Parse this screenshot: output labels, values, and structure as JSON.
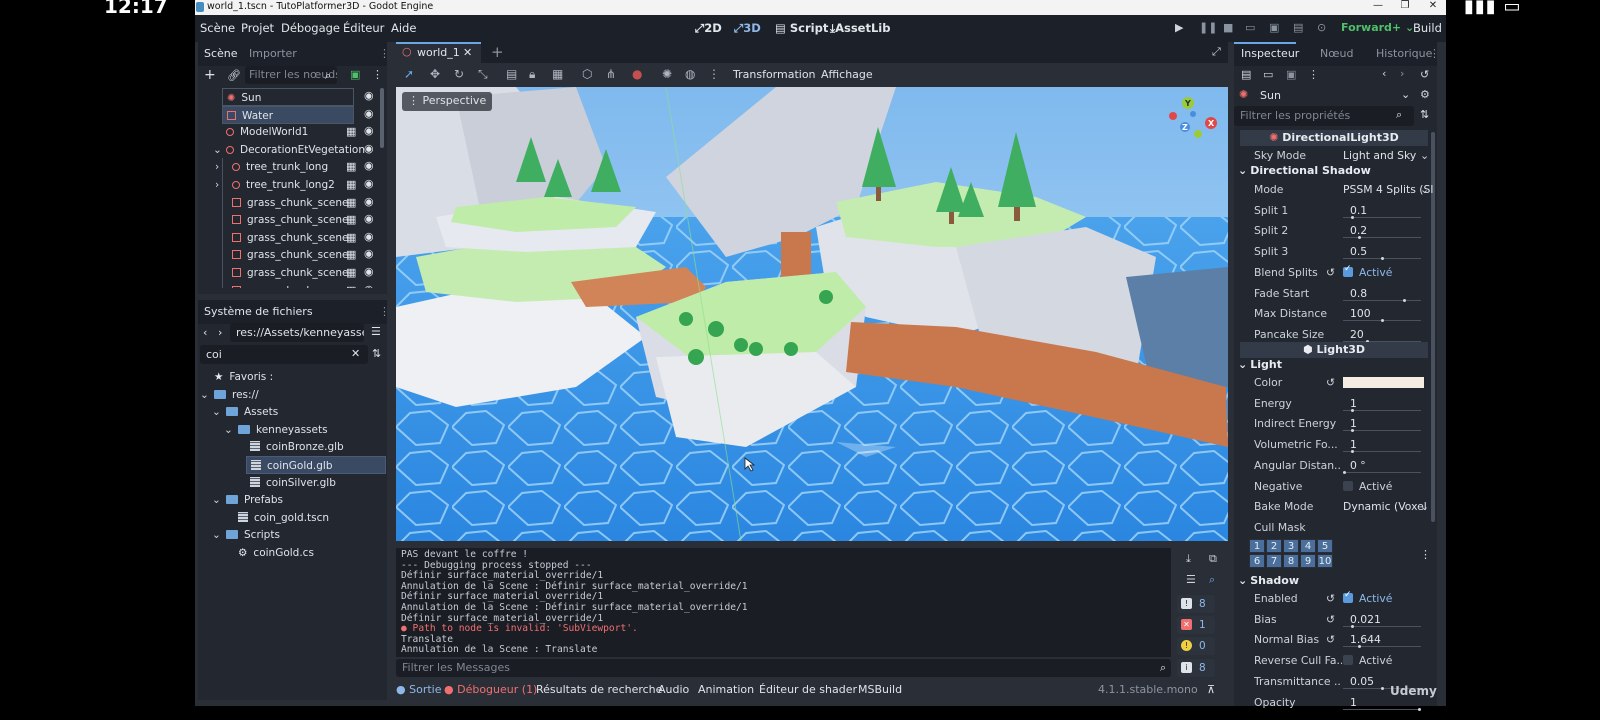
{
  "os": {
    "time": "12:17",
    "status": "▮▮▮ ▭"
  },
  "window": {
    "title": "world_1.tscn - TutoPlatformer3D - Godot Engine",
    "controls": [
      "—",
      "❐",
      "✕"
    ]
  },
  "menu": [
    "Scène",
    "Projet",
    "Débogage",
    "Éditeur",
    "Aide"
  ],
  "workspaces": [
    "2D",
    "3D",
    "Script",
    "AssetLib"
  ],
  "renderer": "Forward+",
  "build": "Build",
  "scene_dock": {
    "tabs": [
      "Scène",
      "Importer"
    ],
    "filter_placeholder": "Filtrer les nœuds",
    "nodes": [
      {
        "name": "Sun",
        "icon": "sun",
        "indent": 0
      },
      {
        "name": "Water",
        "icon": "mesh",
        "indent": 0,
        "selected": true
      },
      {
        "name": "ModelWorld1",
        "icon": "circle",
        "indent": 0,
        "film": true
      },
      {
        "name": "DecorationEtVegetation",
        "icon": "circle",
        "indent": 0,
        "arrow": "⌄"
      },
      {
        "name": "tree_trunk_long",
        "icon": "circle",
        "indent": 1,
        "arrow": "›",
        "film": true
      },
      {
        "name": "tree_trunk_long2",
        "icon": "circle",
        "indent": 1,
        "arrow": "›",
        "film": true
      },
      {
        "name": "grass_chunk_scene",
        "icon": "mesh",
        "indent": 1,
        "film": true
      },
      {
        "name": "grass_chunk_scene",
        "icon": "mesh",
        "indent": 1,
        "film": true
      },
      {
        "name": "grass_chunk_scene",
        "icon": "mesh",
        "indent": 1,
        "film": true
      },
      {
        "name": "grass_chunk_scene",
        "icon": "mesh",
        "indent": 1,
        "film": true
      },
      {
        "name": "grass_chunk_scene",
        "icon": "mesh",
        "indent": 1,
        "film": true
      },
      {
        "name": "grass_chunk_scene",
        "icon": "mesh",
        "indent": 1,
        "film": true
      }
    ]
  },
  "filesystem": {
    "title": "Système de fichiers",
    "path": "res://Assets/kenneyassets",
    "search": "coi",
    "items": [
      {
        "label": "Favoris :",
        "type": "star",
        "indent": 0
      },
      {
        "label": "res://",
        "type": "folder",
        "indent": 0
      },
      {
        "label": "Assets",
        "type": "folder",
        "indent": 1
      },
      {
        "label": "kenneyassets",
        "type": "folder",
        "indent": 2
      },
      {
        "label": "coinBronze.glb",
        "type": "file",
        "indent": 3
      },
      {
        "label": "coinGold.glb",
        "type": "file",
        "indent": 3,
        "selected": true
      },
      {
        "label": "coinSilver.glb",
        "type": "file",
        "indent": 3
      },
      {
        "label": "Prefabs",
        "type": "folder",
        "indent": 1
      },
      {
        "label": "coin_gold.tscn",
        "type": "file",
        "indent": 2
      },
      {
        "label": "Scripts",
        "type": "folder",
        "indent": 1
      },
      {
        "label": "coinGold.cs",
        "type": "gear",
        "indent": 2
      }
    ]
  },
  "editor_tab": "world_1",
  "viewport_toolbar": {
    "transform": "Transformation",
    "view": "Affichage"
  },
  "viewport": {
    "label": "Perspective"
  },
  "console": {
    "lines": [
      {
        "t": "PAS devant le coffre !",
        "e": false
      },
      {
        "t": "--- Debugging process stopped ---",
        "e": false
      },
      {
        "t": "Définir surface_material_override/1",
        "e": false
      },
      {
        "t": "Annulation de la Scene : Définir surface_material_override/1",
        "e": false
      },
      {
        "t": "Définir surface_material_override/1",
        "e": false
      },
      {
        "t": "Annulation de la Scene : Définir surface_material_override/1",
        "e": false
      },
      {
        "t": "Définir surface_material_override/1",
        "e": false
      },
      {
        "t": "● Path to node is invalid: 'SubViewport'.",
        "e": true
      },
      {
        "t": "Translate",
        "e": false
      },
      {
        "t": "Annulation de la Scene : Translate",
        "e": false
      }
    ],
    "filter_placeholder": "Filtrer les Messages",
    "counts": [
      "8",
      "1",
      "0",
      "8"
    ]
  },
  "bottom_tabs": [
    "Sortie",
    "Débogueur (1)",
    "Résultats de recherche",
    "Audio",
    "Animation",
    "Éditeur de shader",
    "MSBuild"
  ],
  "version": "4.1.1.stable.mono",
  "watermark": "Udemy",
  "inspector": {
    "tabs": [
      "Inspecteur",
      "Nœud",
      "Historique"
    ],
    "node": "Sun",
    "filter_placeholder": "Filtrer les propriétés",
    "class1": "DirectionalLight3D",
    "sky_mode": {
      "k": "Sky Mode",
      "v": "Light and Sky"
    },
    "sec_shadow": "Directional Shadow",
    "props1": [
      {
        "k": "Mode",
        "v": "PSSM 4 Splits (Sl",
        "dd": true
      },
      {
        "k": "Split 1",
        "v": "0.1",
        "s": 0.1
      },
      {
        "k": "Split 2",
        "v": "0.2",
        "s": 0.2
      },
      {
        "k": "Split 3",
        "v": "0.5",
        "s": 0.5
      },
      {
        "k": "Blend Splits",
        "v": "Activé",
        "chk": true,
        "rev": true
      },
      {
        "k": "Fade Start",
        "v": "0.8",
        "s": 0.8
      },
      {
        "k": "Max Distance",
        "v": "100",
        "s": 0.5
      },
      {
        "k": "Pancake Size",
        "v": "20",
        "s": 0.3
      }
    ],
    "class2": "Light3D",
    "sec_light": "Light",
    "props2": [
      {
        "k": "Color",
        "color": "#f5ece2",
        "rev": true
      },
      {
        "k": "Energy",
        "v": "1",
        "s": 0.1
      },
      {
        "k": "Indirect Energy",
        "v": "1",
        "s": 0.1
      },
      {
        "k": "Volumetric Fo...",
        "v": "1",
        "s": 0.1
      },
      {
        "k": "Angular Distan...",
        "v": "0 °",
        "s": 0
      },
      {
        "k": "Negative",
        "v": "Activé",
        "chk": false
      },
      {
        "k": "Bake Mode",
        "v": "Dynamic (Voxel",
        "dd": true
      },
      {
        "k": "Cull Mask",
        "v": ""
      }
    ],
    "cull_layers": [
      "1",
      "2",
      "3",
      "4",
      "5",
      "6",
      "7",
      "8",
      "9",
      "10"
    ],
    "sec_shadow2": "Shadow",
    "props3": [
      {
        "k": "Enabled",
        "v": "Activé",
        "chk": true,
        "rev": true
      },
      {
        "k": "Bias",
        "v": "0.021",
        "s": 0.1,
        "rev": true
      },
      {
        "k": "Normal Bias",
        "v": "1.644",
        "s": 0.2,
        "rev": true
      },
      {
        "k": "Reverse Cull Fa...",
        "v": "Activé",
        "chk": false
      },
      {
        "k": "Transmittance ...",
        "v": "0.05",
        "s": 0.5
      },
      {
        "k": "Opacity",
        "v": "1",
        "s": 1
      }
    ]
  }
}
